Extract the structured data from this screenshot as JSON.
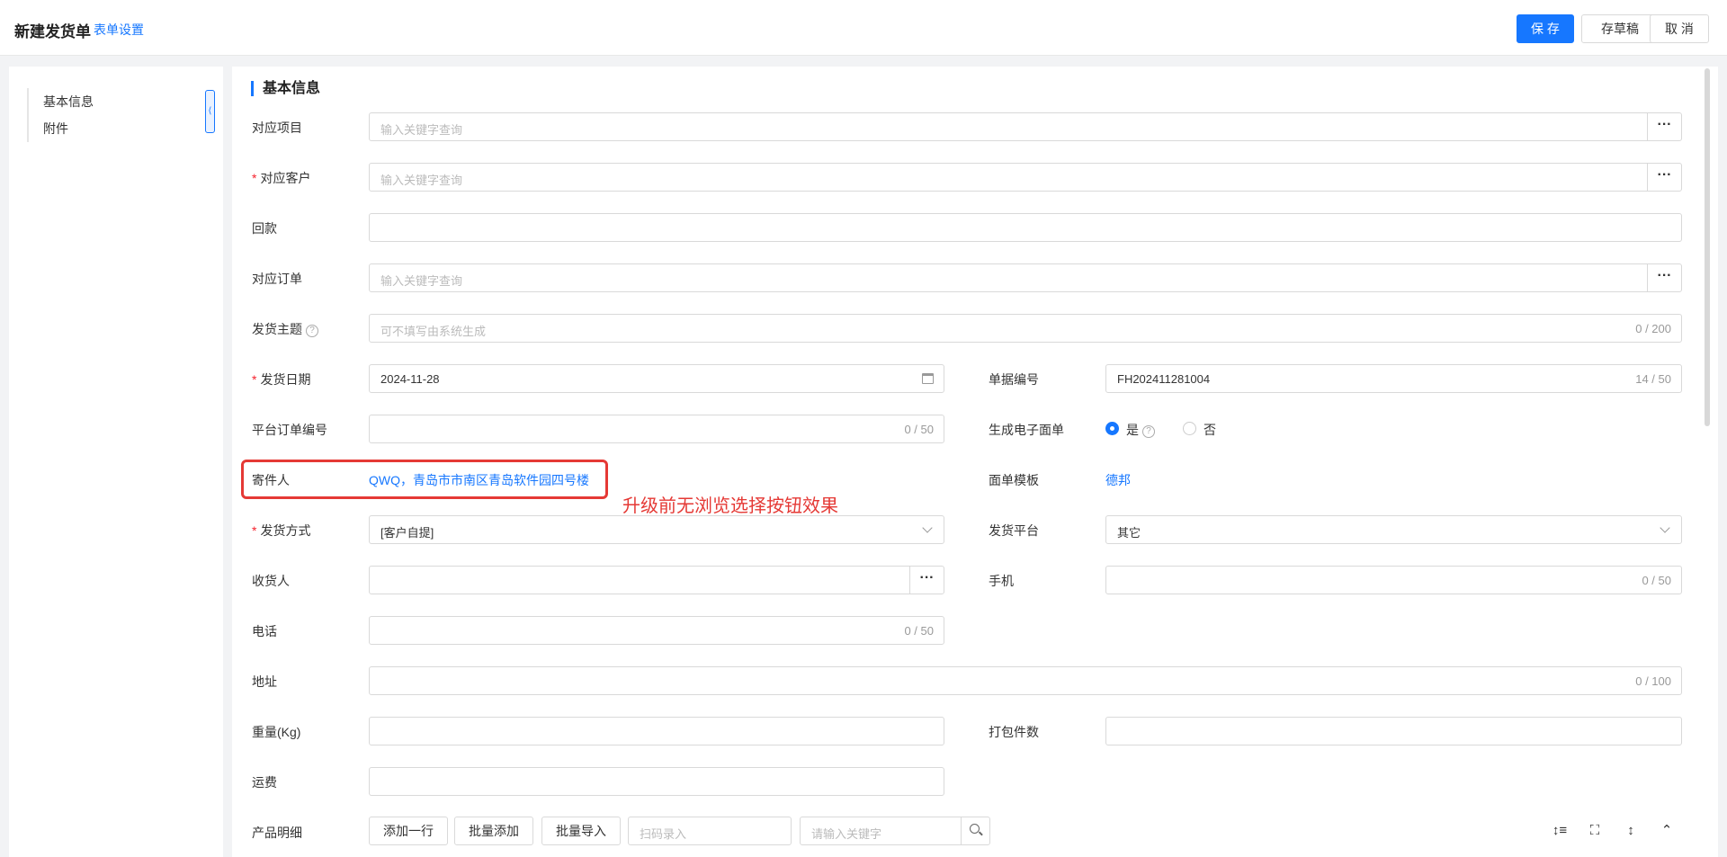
{
  "header": {
    "title": "新建发货单",
    "settings_link": "表单设置",
    "save": "保 存",
    "draft": "存草稿",
    "cancel": "取 消"
  },
  "nav": {
    "items": [
      "基本信息",
      "附件"
    ]
  },
  "section": {
    "title": "基本信息"
  },
  "fields": {
    "project": {
      "label": "对应项目",
      "placeholder": "输入关键字查询"
    },
    "customer": {
      "label": "对应客户",
      "placeholder": "输入关键字查询"
    },
    "payment": {
      "label": "回款"
    },
    "order": {
      "label": "对应订单",
      "placeholder": "输入关键字查询"
    },
    "subject": {
      "label": "发货主题",
      "placeholder": "可不填写由系统生成",
      "counter": "0 / 200"
    },
    "ship_date": {
      "label": "发货日期",
      "value": "2024-11-28"
    },
    "doc_no": {
      "label": "单据编号",
      "value": "FH202411281004",
      "counter": "14 / 50"
    },
    "platform_order": {
      "label": "平台订单编号",
      "counter": "0 / 50"
    },
    "e_waybill": {
      "label": "生成电子面单",
      "yes": "是",
      "no": "否",
      "selected": "是"
    },
    "sender": {
      "label": "寄件人",
      "value": "QWQ，青岛市市南区青岛软件园四号楼"
    },
    "waybill_template": {
      "label": "面单模板",
      "value": "德邦"
    },
    "ship_method": {
      "label": "发货方式",
      "value": "[客户自提]"
    },
    "ship_platform": {
      "label": "发货平台",
      "value": "其它"
    },
    "receiver": {
      "label": "收货人"
    },
    "mobile": {
      "label": "手机",
      "counter": "0 / 50"
    },
    "phone": {
      "label": "电话",
      "counter": "0 / 50"
    },
    "address": {
      "label": "地址",
      "counter": "0 / 100"
    },
    "weight": {
      "label": "重量(Kg)"
    },
    "packages": {
      "label": "打包件数"
    },
    "freight": {
      "label": "运费"
    }
  },
  "products": {
    "label": "产品明细",
    "add_row": "添加一行",
    "batch_add": "批量添加",
    "batch_import": "批量导入",
    "scan_placeholder": "扫码录入",
    "search_placeholder": "请输入关键字"
  },
  "annotation": {
    "text": "升级前无浏览选择按钮效果",
    "color": "#e53935"
  },
  "colors": {
    "primary": "#1677ff",
    "required": "#f5222d"
  }
}
